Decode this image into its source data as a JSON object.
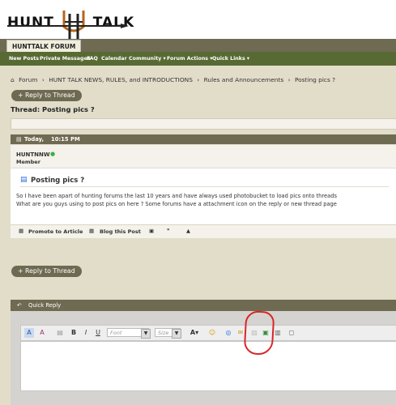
{
  "site": {
    "logo_left": "HUNT",
    "logo_right": "TALK"
  },
  "tabs": [
    "HUNTTALK FORUM"
  ],
  "nav": [
    "New Posts",
    "Private Messages",
    "FAQ",
    "Calendar",
    "Community ▾",
    "Forum Actions ▾",
    "Quick Links ▾"
  ],
  "breadcrumb": [
    "Forum",
    "HUNT TALK NEWS, RULES, and INTRODUCTIONS",
    "Rules and Announcements",
    "Posting pics ?"
  ],
  "buttons": {
    "reply_top": "+ Reply to Thread",
    "reply_bottom": "+ Reply to Thread"
  },
  "thread": {
    "title": "Thread: Posting pics ?"
  },
  "post": {
    "date": "Today,",
    "time": "10:15 PM",
    "username": "HUNTNNW",
    "user_title": "Member",
    "title": "Posting pics ?",
    "line1": "So I have been apart of hunting forums the last 10 years and have always used photobucket to load pics onto threads",
    "line2": "What are you guys using to post pics on here ? Some forums have a attachment icon on the reply or new thread page",
    "actions": [
      "Promote to Article",
      "Blog this Post"
    ]
  },
  "quick_reply": {
    "title": "Quick Reply",
    "font_placeholder": "Font",
    "size_placeholder": "Size"
  },
  "colors": {
    "nav_green": "#586a33",
    "header_brown": "#6f6a52",
    "annotation_red": "#d9262a"
  }
}
